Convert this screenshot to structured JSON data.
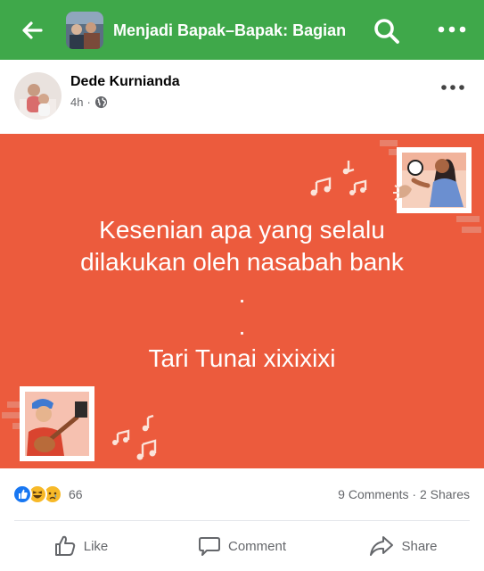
{
  "topbar": {
    "title": "Menjadi Bapak–Bapak: Bagian...",
    "back_icon": "arrow-left-icon",
    "search_icon": "search-icon",
    "more_icon": "more-horizontal-icon",
    "background": "#3fa84a"
  },
  "post": {
    "author": "Dede Kurnianda",
    "time": "4h",
    "separator": "·",
    "privacy_icon": "globe-icon",
    "more_icon": "more-horizontal-icon",
    "card_color": "#ec5b3d",
    "lines": [
      "Kesenian apa yang selalu",
      "dilakukan oleh nasabah bank",
      ".",
      ".",
      "Tari Tunai xixixixi"
    ]
  },
  "reactions": {
    "icons": [
      "like-reaction-icon",
      "haha-reaction-icon",
      "sad-reaction-icon"
    ],
    "count": "66",
    "stats": "9 Comments · 2 Shares"
  },
  "actions": {
    "like": "Like",
    "comment": "Comment",
    "share": "Share"
  }
}
